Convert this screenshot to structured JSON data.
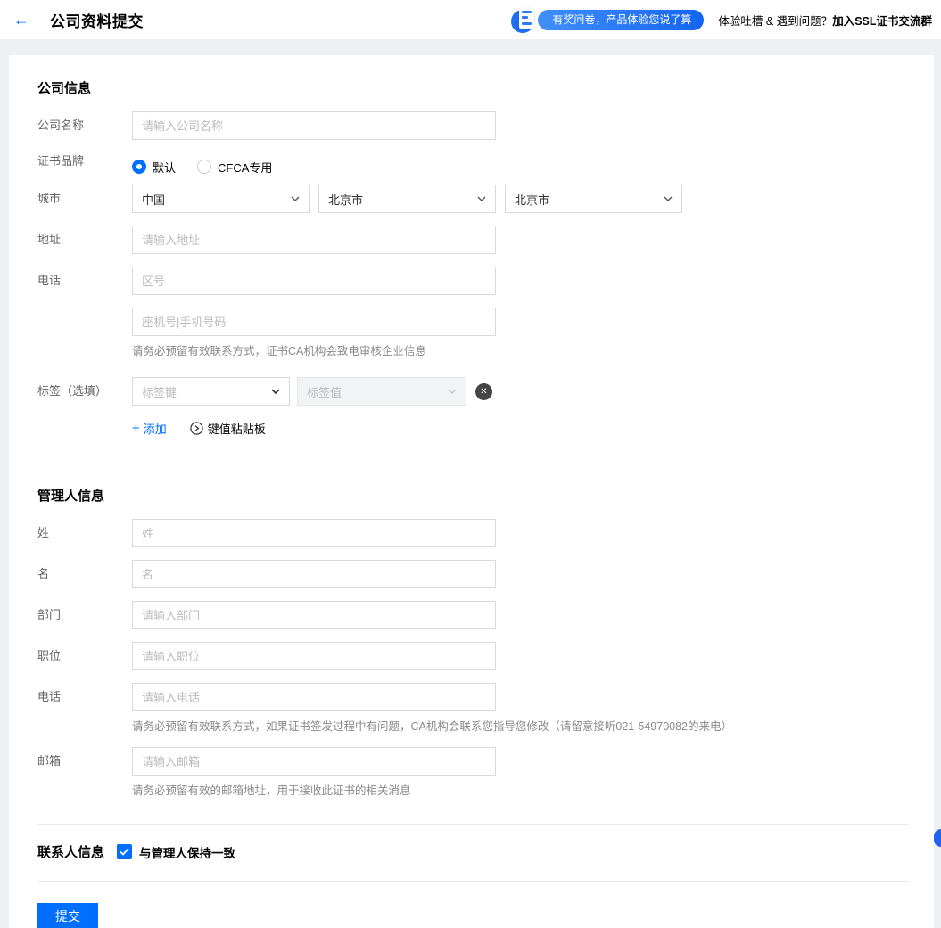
{
  "colors": {
    "accent": "#006eff",
    "banner_gradient_start": "#418ffb",
    "banner_gradient_end": "#1465f0",
    "page_bg": "#eef0f4"
  },
  "icons": {
    "back": "←",
    "close": "✕",
    "plus": "+"
  },
  "header": {
    "title": "公司资料提交",
    "banner_text": "有奖问卷，产品体验您说了算",
    "help_prefix": "体验吐槽 & 遇到问题？",
    "help_link": "加入SSL证书交流群"
  },
  "company_section": {
    "title": "公司信息",
    "company_name": {
      "label": "公司名称",
      "placeholder": "请输入公司名称",
      "value": ""
    },
    "brand": {
      "label": "证书品牌",
      "options": [
        {
          "label": "默认",
          "selected": true
        },
        {
          "label": "CFCA专用",
          "selected": false
        }
      ]
    },
    "city": {
      "label": "城市",
      "selects": [
        "中国",
        "北京市",
        "北京市"
      ]
    },
    "address": {
      "label": "地址",
      "placeholder": "请输入地址",
      "value": ""
    },
    "phone": {
      "label": "电话",
      "area_code_placeholder": "区号",
      "number_placeholder": "座机号|手机号码",
      "hint": "请务必预留有效联系方式，证书CA机构会致电审核企业信息"
    },
    "tags": {
      "label": "标签（选填）",
      "key_placeholder": "标签键",
      "value_placeholder": "标签值",
      "add_label": "添加",
      "paste_label": "键值粘贴板"
    }
  },
  "admin_section": {
    "title": "管理人信息",
    "last_name": {
      "label": "姓",
      "placeholder": "姓",
      "value": ""
    },
    "first_name": {
      "label": "名",
      "placeholder": "名",
      "value": ""
    },
    "department": {
      "label": "部门",
      "placeholder": "请输入部门",
      "value": ""
    },
    "position": {
      "label": "职位",
      "placeholder": "请输入职位",
      "value": ""
    },
    "phone": {
      "label": "电话",
      "placeholder": "请输入电话",
      "hint": "请务必预留有效联系方式，如果证书签发过程中有问题，CA机构会联系您指导您修改（请留意接听021-54970082的来电）"
    },
    "email": {
      "label": "邮箱",
      "placeholder": "请输入邮箱",
      "hint": "请务必预留有效的邮箱地址，用于接收此证书的相关消息"
    }
  },
  "contact_section": {
    "title": "联系人信息",
    "checkbox_label": "与管理人保持一致",
    "checked": true
  },
  "submit_label": "提交"
}
